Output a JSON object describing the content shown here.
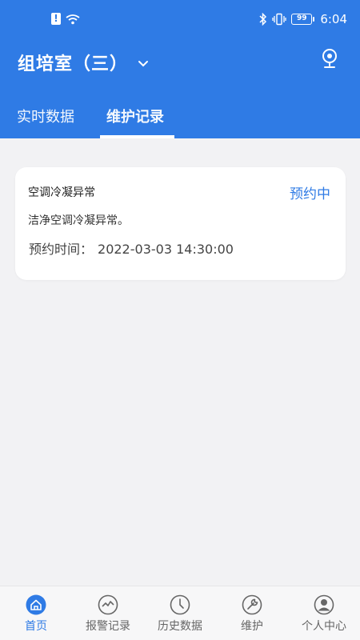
{
  "status_bar": {
    "time": "6:04",
    "battery": "99"
  },
  "header": {
    "title": "组培室（三）",
    "tabs": [
      {
        "label": "实时数据",
        "active": false
      },
      {
        "label": "维护记录",
        "active": true
      }
    ]
  },
  "records": [
    {
      "title": "空调冷凝异常",
      "status": "预约中",
      "description": "洁净空调冷凝异常。",
      "time_label": "预约时间：",
      "time_value": "2022-03-03 14:30:00"
    }
  ],
  "bottom_nav": [
    {
      "label": "首页",
      "icon": "home-icon",
      "active": true
    },
    {
      "label": "报警记录",
      "icon": "alarm-chart-icon",
      "active": false
    },
    {
      "label": "历史数据",
      "icon": "clock-icon",
      "active": false
    },
    {
      "label": "维护",
      "icon": "wrench-icon",
      "active": false
    },
    {
      "label": "个人中心",
      "icon": "user-icon",
      "active": false
    }
  ],
  "colors": {
    "primary": "#2f7be5",
    "background": "#f2f2f4",
    "nav_inactive": "#666666"
  }
}
